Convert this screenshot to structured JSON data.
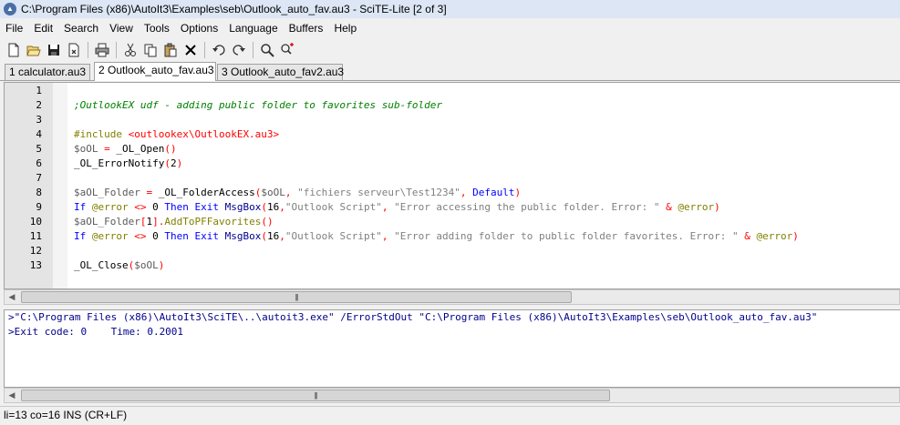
{
  "window": {
    "title": "C:\\Program Files (x86)\\AutoIt3\\Examples\\seb\\Outlook_auto_fav.au3 - SciTE-Lite [2 of 3]"
  },
  "menu": [
    "File",
    "Edit",
    "Search",
    "View",
    "Tools",
    "Options",
    "Language",
    "Buffers",
    "Help"
  ],
  "tabs": [
    {
      "label": "1 calculator.au3",
      "active": false
    },
    {
      "label": "2 Outlook_auto_fav.au3",
      "active": true
    },
    {
      "label": "3 Outlook_auto_fav2.au3",
      "active": false
    }
  ],
  "editor": {
    "line_numbers": [
      "1",
      "2",
      "3",
      "4",
      "5",
      "6",
      "7",
      "8",
      "9",
      "10",
      "11",
      "12",
      "13"
    ],
    "lines": [
      [],
      [
        {
          "t": ";OutlookEX udf - adding public folder to favorites sub-folder",
          "c": "comment"
        }
      ],
      [],
      [
        {
          "t": "#include ",
          "c": "directive"
        },
        {
          "t": "<outlookex\\OutlookEX.au3>",
          "c": "include"
        }
      ],
      [
        {
          "t": "$oOL",
          "c": "var"
        },
        {
          "t": " = ",
          "c": "op"
        },
        {
          "t": "_OL_Open",
          "c": "plain"
        },
        {
          "t": "()",
          "c": "op"
        }
      ],
      [
        {
          "t": "_OL_ErrorNotify",
          "c": "plain"
        },
        {
          "t": "(",
          "c": "op"
        },
        {
          "t": "2",
          "c": "num"
        },
        {
          "t": ")",
          "c": "op"
        }
      ],
      [],
      [
        {
          "t": "$aOL_Folder",
          "c": "var"
        },
        {
          "t": " = ",
          "c": "op"
        },
        {
          "t": "_OL_FolderAccess",
          "c": "plain"
        },
        {
          "t": "(",
          "c": "op"
        },
        {
          "t": "$oOL",
          "c": "var"
        },
        {
          "t": ", ",
          "c": "op"
        },
        {
          "t": "\"fichiers serveur\\Test1234\"",
          "c": "str"
        },
        {
          "t": ", ",
          "c": "op"
        },
        {
          "t": "Default",
          "c": "kw"
        },
        {
          "t": ")",
          "c": "op"
        }
      ],
      [
        {
          "t": "If ",
          "c": "kw"
        },
        {
          "t": "@error",
          "c": "macro"
        },
        {
          "t": " <> ",
          "c": "op"
        },
        {
          "t": "0",
          "c": "num"
        },
        {
          "t": " Then Exit ",
          "c": "kw"
        },
        {
          "t": "MsgBox",
          "c": "func"
        },
        {
          "t": "(",
          "c": "op"
        },
        {
          "t": "16",
          "c": "num"
        },
        {
          "t": ",",
          "c": "op"
        },
        {
          "t": "\"Outlook Script\"",
          "c": "str"
        },
        {
          "t": ", ",
          "c": "op"
        },
        {
          "t": "\"Error accessing the public folder. Error: \"",
          "c": "str"
        },
        {
          "t": " & ",
          "c": "op"
        },
        {
          "t": "@error",
          "c": "macro"
        },
        {
          "t": ")",
          "c": "op"
        }
      ],
      [
        {
          "t": "$aOL_Folder",
          "c": "var"
        },
        {
          "t": "[",
          "c": "op"
        },
        {
          "t": "1",
          "c": "num"
        },
        {
          "t": "].",
          "c": "op"
        },
        {
          "t": "AddToPFFavorites",
          "c": "macro"
        },
        {
          "t": "()",
          "c": "op"
        }
      ],
      [
        {
          "t": "If ",
          "c": "kw"
        },
        {
          "t": "@error",
          "c": "macro"
        },
        {
          "t": " <> ",
          "c": "op"
        },
        {
          "t": "0",
          "c": "num"
        },
        {
          "t": " Then Exit ",
          "c": "kw"
        },
        {
          "t": "MsgBox",
          "c": "func"
        },
        {
          "t": "(",
          "c": "op"
        },
        {
          "t": "16",
          "c": "num"
        },
        {
          "t": ",",
          "c": "op"
        },
        {
          "t": "\"Outlook Script\"",
          "c": "str"
        },
        {
          "t": ", ",
          "c": "op"
        },
        {
          "t": "\"Error adding folder to public folder favorites. Error: \"",
          "c": "str"
        },
        {
          "t": " & ",
          "c": "op"
        },
        {
          "t": "@error",
          "c": "macro"
        },
        {
          "t": ")",
          "c": "op"
        }
      ],
      [],
      [
        {
          "t": "_OL_Close",
          "c": "plain"
        },
        {
          "t": "(",
          "c": "op"
        },
        {
          "t": "$oOL",
          "c": "var"
        },
        {
          "t": ")",
          "c": "op"
        }
      ]
    ]
  },
  "output": {
    "lines": [
      ">\"C:\\Program Files (x86)\\AutoIt3\\SciTE\\..\\autoit3.exe\" /ErrorStdOut \"C:\\Program Files (x86)\\AutoIt3\\Examples\\seb\\Outlook_auto_fav.au3\"",
      ">Exit code: 0    Time: 0.2001"
    ]
  },
  "statusbar": {
    "text": "li=13 co=16 INS (CR+LF)"
  },
  "icons": {
    "toolbar": [
      "new-file-icon",
      "open-folder-icon",
      "save-icon",
      "close-file-icon",
      "print-icon",
      "cut-icon",
      "copy-icon",
      "paste-icon",
      "delete-icon",
      "undo-icon",
      "redo-icon",
      "find-icon",
      "replace-icon"
    ]
  },
  "colors": {
    "comment": "#008000",
    "keyword": "#0000ff",
    "string": "#808080",
    "macro": "#808000",
    "operator": "#ff0000",
    "output_text": "#00008b"
  }
}
